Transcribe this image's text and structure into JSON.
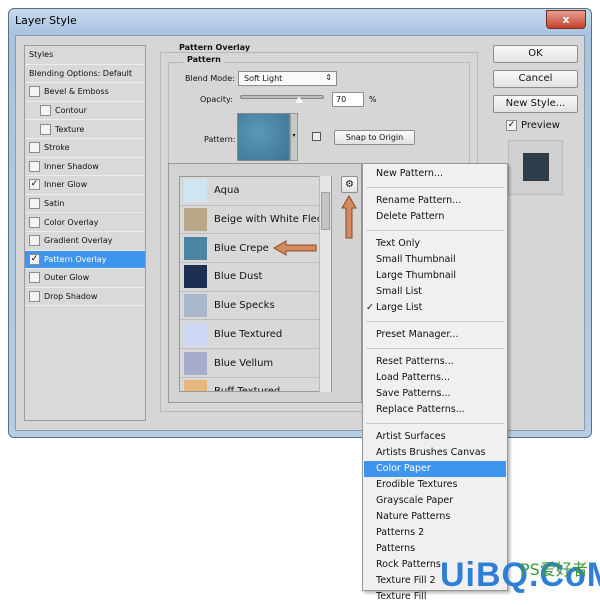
{
  "window": {
    "title": "Layer Style",
    "close": "x"
  },
  "styles": {
    "items": [
      {
        "label": "Styles",
        "checkbox": false
      },
      {
        "label": "Blending Options: Default",
        "checkbox": false
      },
      {
        "label": "Bevel & Emboss",
        "checkbox": true,
        "checked": false
      },
      {
        "label": "Contour",
        "checkbox": true,
        "checked": false,
        "indent": true
      },
      {
        "label": "Texture",
        "checkbox": true,
        "checked": false,
        "indent": true
      },
      {
        "label": "Stroke",
        "checkbox": true,
        "checked": false
      },
      {
        "label": "Inner Shadow",
        "checkbox": true,
        "checked": false
      },
      {
        "label": "Inner Glow",
        "checkbox": true,
        "checked": true
      },
      {
        "label": "Satin",
        "checkbox": true,
        "checked": false
      },
      {
        "label": "Color Overlay",
        "checkbox": true,
        "checked": false
      },
      {
        "label": "Gradient Overlay",
        "checkbox": true,
        "checked": false
      },
      {
        "label": "Pattern Overlay",
        "checkbox": true,
        "checked": true,
        "selected": true
      },
      {
        "label": "Outer Glow",
        "checkbox": true,
        "checked": false
      },
      {
        "label": "Drop Shadow",
        "checkbox": true,
        "checked": false
      }
    ]
  },
  "panel": {
    "group_title": "Pattern Overlay",
    "sub_title": "Pattern",
    "blend_label": "Blend Mode:",
    "blend_value": "Soft Light",
    "opacity_label": "Opacity:",
    "opacity_value": "70",
    "opacity_unit": "%",
    "opacity_percent": 70,
    "pattern_label": "Pattern:",
    "snap_label": "Snap to Origin"
  },
  "buttons": {
    "ok": "OK",
    "cancel": "Cancel",
    "new_style": "New Style...",
    "preview": "Preview",
    "preview_checked": true
  },
  "patterns": [
    {
      "name": "Aqua",
      "color": "#cfe6f2"
    },
    {
      "name": "Beige with White Fleck",
      "color": "#b9a888"
    },
    {
      "name": "Blue Crepe",
      "color": "#4c84a4"
    },
    {
      "name": "Blue Dust",
      "color": "#1c2f52"
    },
    {
      "name": "Blue Specks",
      "color": "#a9b7cc"
    },
    {
      "name": "Blue Textured",
      "color": "#cdd8f5"
    },
    {
      "name": "Blue Vellum",
      "color": "#a8aacb"
    },
    {
      "name": "Buff Textured",
      "color": "#e6b67c"
    }
  ],
  "menu": {
    "groups": [
      [
        "New Pattern..."
      ],
      [
        "Rename Pattern...",
        "Delete Pattern"
      ],
      [
        "Text Only",
        "Small Thumbnail",
        "Large Thumbnail",
        "Small List",
        "Large List"
      ],
      [
        "Preset Manager..."
      ],
      [
        "Reset Patterns...",
        "Load Patterns...",
        "Save Patterns...",
        "Replace Patterns..."
      ],
      [
        "Artist Surfaces",
        "Artists Brushes Canvas",
        "Color Paper",
        "Erodible Textures",
        "Grayscale Paper",
        "Nature Patterns",
        "Patterns 2",
        "Patterns",
        "Rock Patterns",
        "Texture Fill 2",
        "Texture Fill"
      ]
    ],
    "checked": "Large List",
    "highlighted": "Color Paper"
  },
  "watermark": {
    "text": "UiBQ.CoM",
    "sub": "PS爱好者",
    "url": "www.psahz.com"
  },
  "colors": {
    "accent": "#3d95ee",
    "arrow": "#c97a4e"
  }
}
